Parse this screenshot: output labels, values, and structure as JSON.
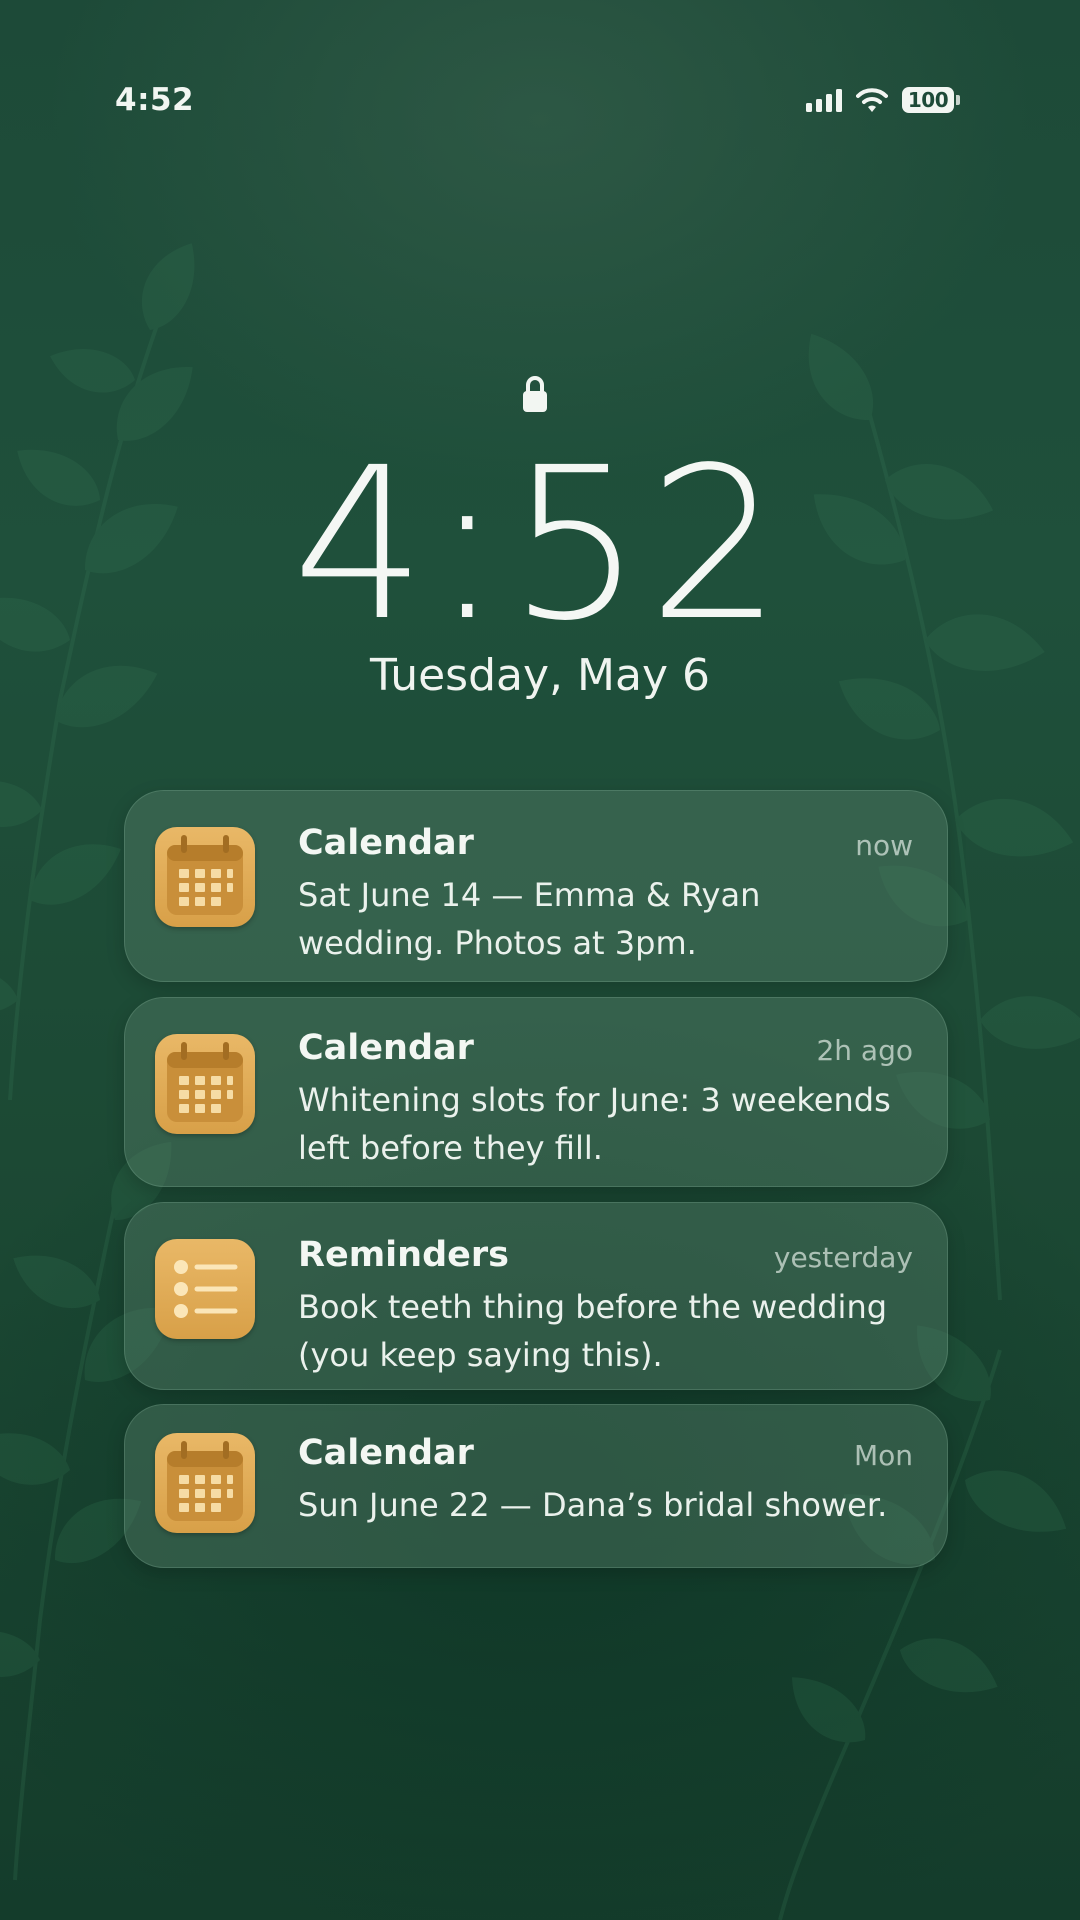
{
  "status_bar": {
    "time": "4:52",
    "battery": "100",
    "icons": [
      "cellular-signal-icon",
      "wifi-icon",
      "battery-icon"
    ]
  },
  "lock_screen": {
    "icon": "lock-icon",
    "time": "4:52",
    "date": "Tuesday, May 6"
  },
  "notifications": [
    {
      "app": "Calendar",
      "icon": "calendar-icon",
      "time": "now",
      "body": "Sat June 14 — Emma & Ryan wedding. Photos at 3pm."
    },
    {
      "app": "Calendar",
      "icon": "calendar-icon",
      "time": "2h ago",
      "body": "Whitening slots for June: 3 weekends left before they fill."
    },
    {
      "app": "Reminders",
      "icon": "reminders-list-icon",
      "time": "yesterday",
      "body": "Book teeth thing before the wedding (you keep saying this)."
    },
    {
      "app": "Calendar",
      "icon": "calendar-icon",
      "time": "Mon",
      "body": "Sun June 22 — Dana’s bridal shower."
    }
  ],
  "colors": {
    "background": "#1d4a38",
    "app_icon": "#e0ac58",
    "notification_bg": "rgba(88,128,108,0.42)"
  }
}
